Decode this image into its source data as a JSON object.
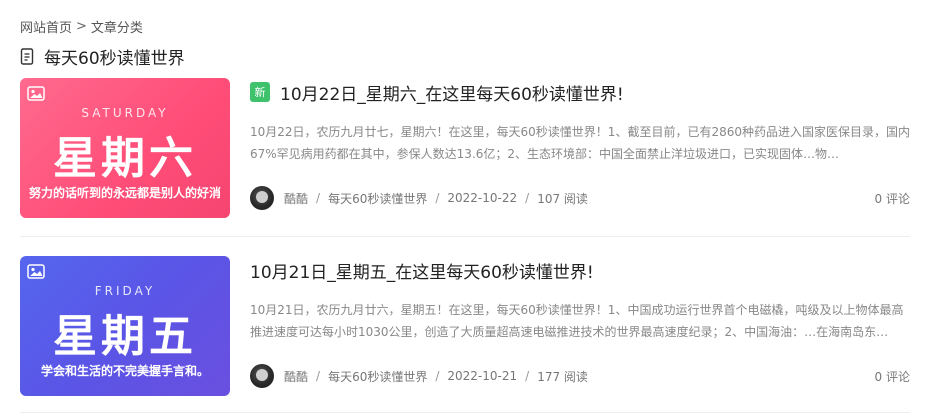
{
  "breadcrumb": {
    "home": "网站首页",
    "separator": ">",
    "category": "文章分类"
  },
  "page": {
    "title": "每天60秒读懂世界",
    "title_icon": "document-icon"
  },
  "posts": [
    {
      "badge": "新",
      "title": "10月22日_星期六_在这里每天60秒读懂世界!",
      "excerpt": "10月22日，农历九月廿七，星期六！在这里，每天60秒读懂世界！1、截至目前，已有2860种药品进入国家医保目录，国内67%罕见病用药都在其中，参保人数达13.6亿；2、生态环境部：中国全面禁止洋垃圾进口，已实现固体…物…",
      "author": "酷酷",
      "category": "每天60秒读懂世界",
      "date": "2022-10-22",
      "reads": "107 阅读",
      "comments": "0 评论",
      "thumb": {
        "en": "SATURDAY",
        "cn": "星期六",
        "slogan": "努力的话听到的永远都是别人的好消",
        "color": "#ff4d78"
      }
    },
    {
      "badge": "",
      "title": "10月21日_星期五_在这里每天60秒读懂世界!",
      "excerpt": "10月21日，农历九月廿六，星期五！在这里，每天60秒读懂世界！1、中国成功运行世界首个电磁橇，吨级及以上物体最高推进速度可达每小时1030公里，创造了大质量超高速电磁推进技术的世界最高速度纪录；2、中国海油：…在海南岛东…",
      "author": "酷酷",
      "category": "每天60秒读懂世界",
      "date": "2022-10-21",
      "reads": "177 阅读",
      "comments": "0 评论",
      "thumb": {
        "en": "FRIDAY",
        "cn": "星期五",
        "slogan": "学会和生活的不完美握手言和。",
        "color": "#5a55e6"
      }
    }
  ],
  "meta_separator": "/"
}
